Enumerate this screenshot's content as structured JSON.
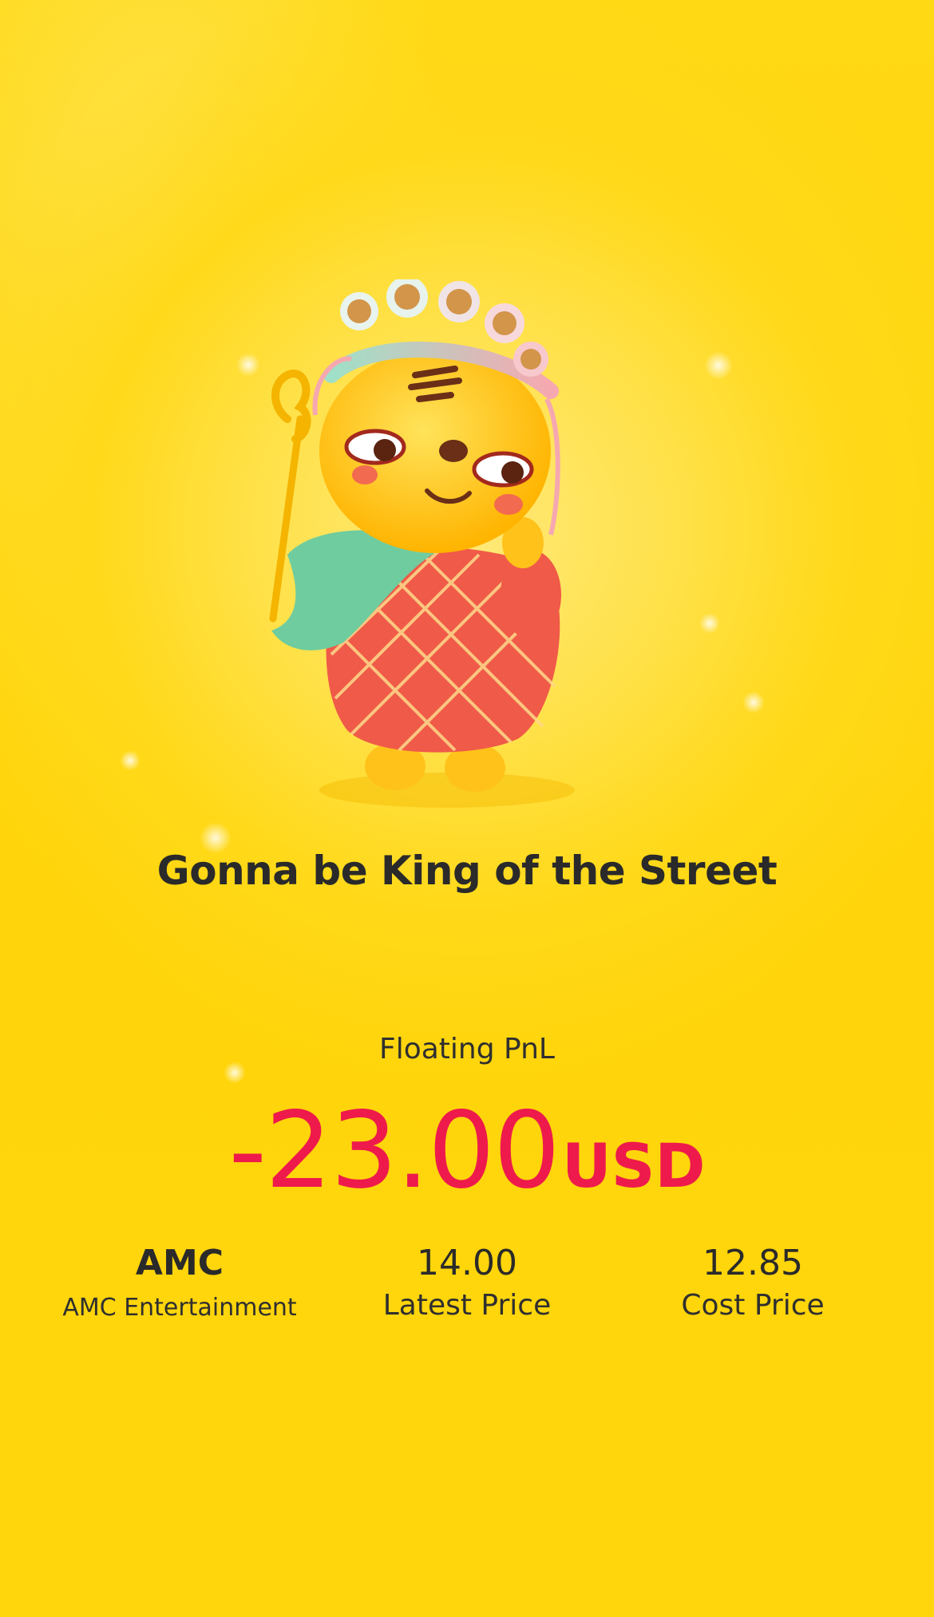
{
  "headline": "Gonna be King of the Street",
  "pnl": {
    "label": "Floating PnL",
    "value": "-23.00",
    "currency": "USD",
    "color": "#ee1a4c"
  },
  "stats": [
    {
      "value": "AMC",
      "label": "AMC Entertainment"
    },
    {
      "value": "14.00",
      "label": "Latest Price"
    },
    {
      "value": "12.85",
      "label": "Cost Price"
    }
  ],
  "mascot": {
    "icon": "tiger-king-mascot"
  },
  "colors": {
    "background": "#ffd60a",
    "text": "#2a2a2a",
    "loss": "#ee1a4c"
  }
}
